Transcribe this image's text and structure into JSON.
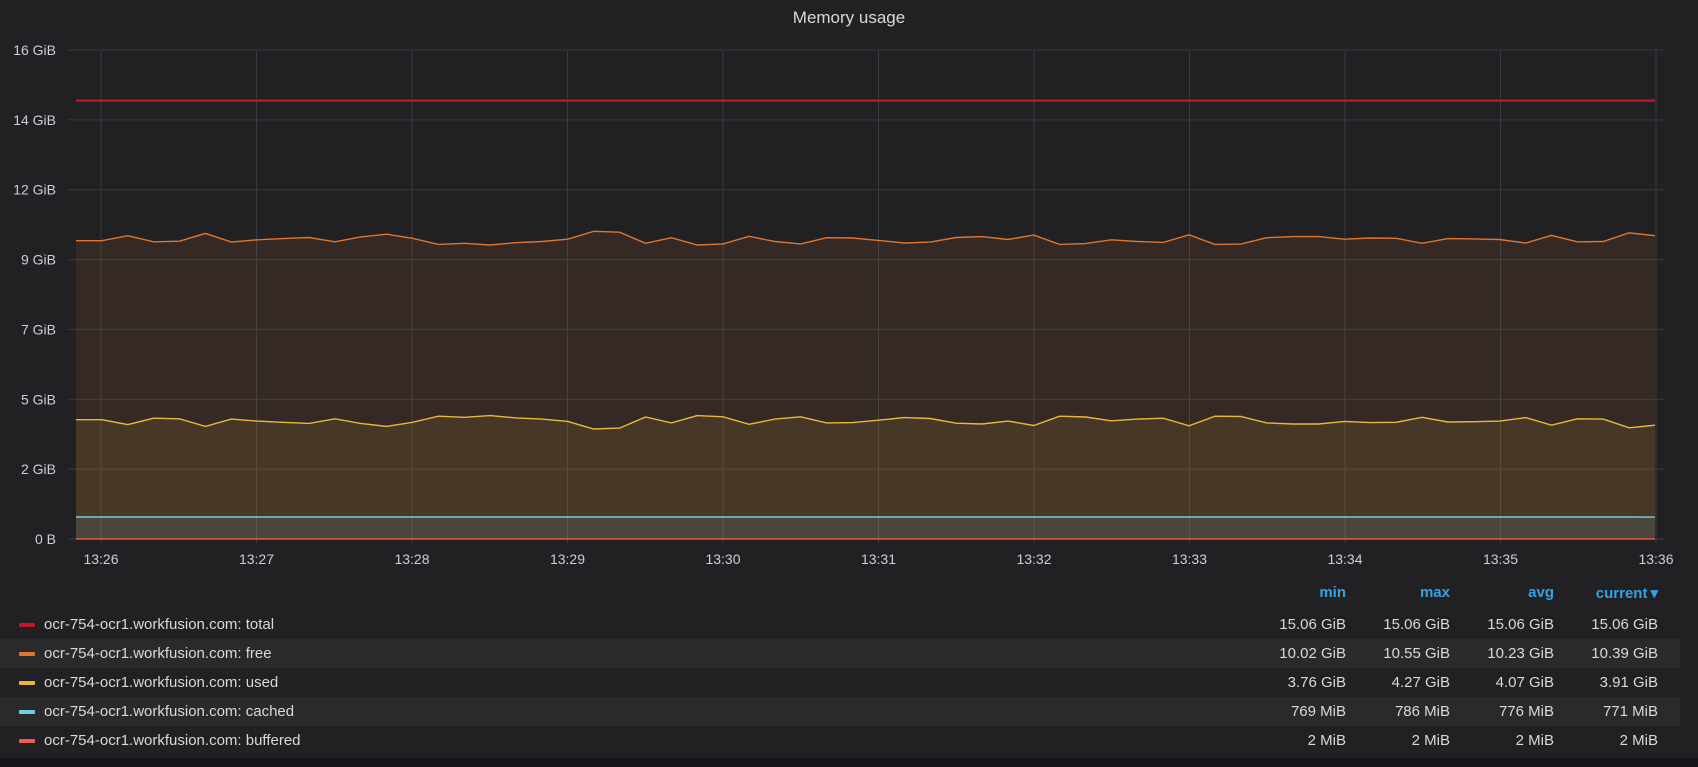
{
  "panel": {
    "title": "Memory usage"
  },
  "chart_data": {
    "type": "area",
    "title": "Memory usage",
    "y_ticks": [
      "16 GiB",
      "14 GiB",
      "12 GiB",
      "9 GiB",
      "7 GiB",
      "5 GiB",
      "2 GiB",
      "0 B"
    ],
    "ylim_gib": [
      0,
      16.8
    ],
    "x_ticks": [
      "13:26",
      "13:27",
      "13:28",
      "13:29",
      "13:30",
      "13:31",
      "13:32",
      "13:33",
      "13:34",
      "13:35",
      "13:36"
    ],
    "x_range": [
      "13:25:50",
      "13:36:00"
    ],
    "grid": true,
    "series": [
      {
        "name": "ocr-754-ocr1.workfusion.com: total",
        "color": "#c4162a",
        "fill": false,
        "values": [
          15.06,
          15.06,
          15.06,
          15.06,
          15.06,
          15.06,
          15.06,
          15.06,
          15.06,
          15.06,
          15.06,
          15.06,
          15.06,
          15.06,
          15.06,
          15.06,
          15.06,
          15.06,
          15.06,
          15.06,
          15.06,
          15.06,
          15.06,
          15.06,
          15.06,
          15.06,
          15.06,
          15.06,
          15.06,
          15.06,
          15.06,
          15.06,
          15.06,
          15.06,
          15.06,
          15.06,
          15.06,
          15.06,
          15.06,
          15.06,
          15.06,
          15.06,
          15.06,
          15.06,
          15.06,
          15.06,
          15.06,
          15.06,
          15.06,
          15.06,
          15.06,
          15.06,
          15.06,
          15.06,
          15.06,
          15.06,
          15.06,
          15.06,
          15.06,
          15.06,
          15.06,
          15.06
        ]
      },
      {
        "name": "ocr-754-ocr1.workfusion.com: free",
        "color": "#e0752d",
        "fill": true,
        "values": [
          10.25,
          10.25,
          10.42,
          10.21,
          10.23,
          10.5,
          10.2,
          10.28,
          10.32,
          10.36,
          10.21,
          10.38,
          10.47,
          10.33,
          10.12,
          10.16,
          10.1,
          10.18,
          10.22,
          10.3,
          10.57,
          10.54,
          10.16,
          10.35,
          10.1,
          10.14,
          10.4,
          10.22,
          10.14,
          10.35,
          10.34,
          10.26,
          10.17,
          10.2,
          10.36,
          10.39,
          10.29,
          10.44,
          10.12,
          10.15,
          10.28,
          10.22,
          10.19,
          10.45,
          10.12,
          10.13,
          10.35,
          10.39,
          10.39,
          10.3,
          10.34,
          10.33,
          10.16,
          10.32,
          10.31,
          10.29,
          10.17,
          10.43,
          10.21,
          10.22,
          10.52,
          10.42
        ]
      },
      {
        "name": "ocr-754-ocr1.workfusion.com: used",
        "color": "#eab839",
        "fill": true,
        "values": [
          4.1,
          4.1,
          3.93,
          4.15,
          4.13,
          3.87,
          4.12,
          4.05,
          4.01,
          3.97,
          4.13,
          3.97,
          3.87,
          4.01,
          4.22,
          4.18,
          4.24,
          4.16,
          4.12,
          4.04,
          3.78,
          3.81,
          4.19,
          3.99,
          4.24,
          4.2,
          3.94,
          4.12,
          4.2,
          3.99,
          4.0,
          4.08,
          4.17,
          4.14,
          3.98,
          3.95,
          4.05,
          3.9,
          4.22,
          4.19,
          4.06,
          4.12,
          4.15,
          3.89,
          4.22,
          4.21,
          3.99,
          3.95,
          3.95,
          4.04,
          4.0,
          4.01,
          4.18,
          4.02,
          4.03,
          4.05,
          4.17,
          3.91,
          4.13,
          4.12,
          3.82,
          3.91
        ]
      },
      {
        "name": "ocr-754-ocr1.workfusion.com: cached",
        "color": "#6ed0e0",
        "fill": true,
        "values": [
          0.757,
          0.757,
          0.757,
          0.757,
          0.757,
          0.757,
          0.757,
          0.757,
          0.757,
          0.757,
          0.757,
          0.757,
          0.757,
          0.757,
          0.757,
          0.757,
          0.757,
          0.757,
          0.757,
          0.757,
          0.757,
          0.757,
          0.757,
          0.757,
          0.757,
          0.757,
          0.757,
          0.757,
          0.757,
          0.757,
          0.757,
          0.757,
          0.757,
          0.757,
          0.757,
          0.757,
          0.757,
          0.757,
          0.757,
          0.757,
          0.757,
          0.757,
          0.757,
          0.757,
          0.757,
          0.757,
          0.757,
          0.757,
          0.757,
          0.757,
          0.757,
          0.757,
          0.757,
          0.757,
          0.757,
          0.757,
          0.757,
          0.757,
          0.757,
          0.757,
          0.757,
          0.753
        ]
      },
      {
        "name": "ocr-754-ocr1.workfusion.com: buffered",
        "color": "#ef5d4b",
        "fill": true,
        "values": [
          0.002,
          0.002,
          0.002,
          0.002,
          0.002,
          0.002,
          0.002,
          0.002,
          0.002,
          0.002,
          0.002,
          0.002,
          0.002,
          0.002,
          0.002,
          0.002,
          0.002,
          0.002,
          0.002,
          0.002,
          0.002,
          0.002,
          0.002,
          0.002,
          0.002,
          0.002,
          0.002,
          0.002,
          0.002,
          0.002,
          0.002,
          0.002,
          0.002,
          0.002,
          0.002,
          0.002,
          0.002,
          0.002,
          0.002,
          0.002,
          0.002,
          0.002,
          0.002,
          0.002,
          0.002,
          0.002,
          0.002,
          0.002,
          0.002,
          0.002,
          0.002,
          0.002,
          0.002,
          0.002,
          0.002,
          0.002,
          0.002,
          0.002,
          0.002,
          0.002,
          0.002,
          0.002
        ]
      }
    ]
  },
  "legend": {
    "columns": [
      "min",
      "max",
      "avg",
      "current"
    ],
    "sort_indicator": "▾",
    "rows": [
      {
        "name": "ocr-754-ocr1.workfusion.com: total",
        "color": "#c4162a",
        "min": "15.06 GiB",
        "max": "15.06 GiB",
        "avg": "15.06 GiB",
        "current": "15.06 GiB"
      },
      {
        "name": "ocr-754-ocr1.workfusion.com: free",
        "color": "#e0752d",
        "min": "10.02 GiB",
        "max": "10.55 GiB",
        "avg": "10.23 GiB",
        "current": "10.39 GiB"
      },
      {
        "name": "ocr-754-ocr1.workfusion.com: used",
        "color": "#eab839",
        "min": "3.76 GiB",
        "max": "4.27 GiB",
        "avg": "4.07 GiB",
        "current": "3.91 GiB"
      },
      {
        "name": "ocr-754-ocr1.workfusion.com: cached",
        "color": "#6ed0e0",
        "min": "769 MiB",
        "max": "786 MiB",
        "avg": "776 MiB",
        "current": "771 MiB"
      },
      {
        "name": "ocr-754-ocr1.workfusion.com: buffered",
        "color": "#ef5d4b",
        "min": "2 MiB",
        "max": "2 MiB",
        "avg": "2 MiB",
        "current": "2 MiB"
      }
    ]
  }
}
